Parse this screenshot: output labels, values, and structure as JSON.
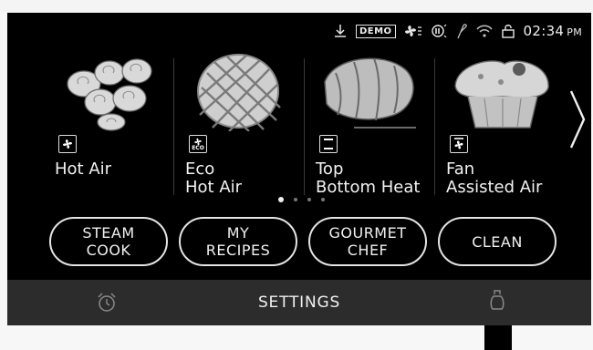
{
  "status": {
    "demo_label": "DEMO",
    "time": "02:34",
    "ampm": "PM",
    "icons": [
      "download-icon",
      "fan-icon",
      "steam-icon",
      "probe-icon",
      "wifi-icon",
      "lock-icon"
    ]
  },
  "modes": [
    {
      "line1": "Hot Air",
      "line2": "",
      "icon": "fan-icon"
    },
    {
      "line1": "Eco",
      "line2": "Hot Air",
      "icon": "eco-fan-icon"
    },
    {
      "line1": "Top",
      "line2": "Bottom Heat",
      "icon": "top-bottom-heat-icon"
    },
    {
      "line1": "Fan",
      "line2": "Assisted Air",
      "icon": "fan-assisted-icon"
    }
  ],
  "pager": {
    "count": 4,
    "active": 1
  },
  "buttons": [
    {
      "line1": "STEAM",
      "line2": "COOK"
    },
    {
      "line1": "MY",
      "line2": "RECIPES"
    },
    {
      "line1": "GOURMET",
      "line2": "CHEF"
    },
    {
      "line1": "CLEAN",
      "line2": ""
    }
  ],
  "bottom": {
    "settings_label": "SETTINGS"
  },
  "colors": {
    "screen_bg": "#000000",
    "bottom_bar": "#2c2c2c",
    "text": "#f0f0f0"
  }
}
